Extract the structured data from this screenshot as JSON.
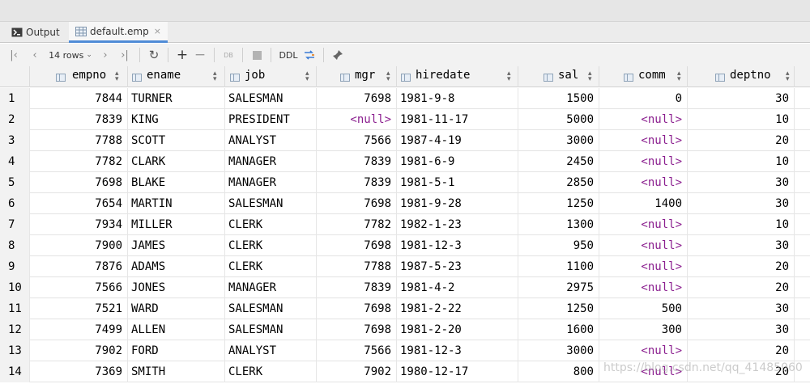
{
  "tabs": [
    {
      "label": "Output",
      "icon": "output-console-icon"
    },
    {
      "label": "default.emp",
      "icon": "table-grid-icon",
      "close": "×"
    }
  ],
  "toolbar": {
    "rows_label": "14 rows",
    "ddl_label": "DDL",
    "icons": [
      "first-page-icon",
      "prev-page-icon",
      "next-page-icon",
      "last-page-icon",
      "refresh-icon",
      "add-row-icon",
      "remove-row-icon",
      "db-submit-icon",
      "stop-icon",
      "compare-icon",
      "pin-icon"
    ]
  },
  "columns": [
    "empno",
    "ename",
    "job",
    "mgr",
    "hiredate",
    "sal",
    "comm",
    "deptno"
  ],
  "null_text": "<null>",
  "rows": [
    [
      "1",
      "7844",
      "TURNER",
      "SALESMAN",
      "7698",
      "1981-9-8",
      "1500",
      "0",
      "30"
    ],
    [
      "2",
      "7839",
      "KING",
      "PRESIDENT",
      "<null>",
      "1981-11-17",
      "5000",
      "<null>",
      "10"
    ],
    [
      "3",
      "7788",
      "SCOTT",
      "ANALYST",
      "7566",
      "1987-4-19",
      "3000",
      "<null>",
      "20"
    ],
    [
      "4",
      "7782",
      "CLARK",
      "MANAGER",
      "7839",
      "1981-6-9",
      "2450",
      "<null>",
      "10"
    ],
    [
      "5",
      "7698",
      "BLAKE",
      "MANAGER",
      "7839",
      "1981-5-1",
      "2850",
      "<null>",
      "30"
    ],
    [
      "6",
      "7654",
      "MARTIN",
      "SALESMAN",
      "7698",
      "1981-9-28",
      "1250",
      "1400",
      "30"
    ],
    [
      "7",
      "7934",
      "MILLER",
      "CLERK",
      "7782",
      "1982-1-23",
      "1300",
      "<null>",
      "10"
    ],
    [
      "8",
      "7900",
      "JAMES",
      "CLERK",
      "7698",
      "1981-12-3",
      "950",
      "<null>",
      "30"
    ],
    [
      "9",
      "7876",
      "ADAMS",
      "CLERK",
      "7788",
      "1987-5-23",
      "1100",
      "<null>",
      "20"
    ],
    [
      "10",
      "7566",
      "JONES",
      "MANAGER",
      "7839",
      "1981-4-2",
      "2975",
      "<null>",
      "20"
    ],
    [
      "11",
      "7521",
      "WARD",
      "SALESMAN",
      "7698",
      "1981-2-22",
      "1250",
      "500",
      "30"
    ],
    [
      "12",
      "7499",
      "ALLEN",
      "SALESMAN",
      "7698",
      "1981-2-20",
      "1600",
      "300",
      "30"
    ],
    [
      "13",
      "7902",
      "FORD",
      "ANALYST",
      "7566",
      "1981-12-3",
      "3000",
      "<null>",
      "20"
    ],
    [
      "14",
      "7369",
      "SMITH",
      "CLERK",
      "7902",
      "1980-12-17",
      "800",
      "<null>",
      "20"
    ]
  ],
  "watermark": "https://blog.csdn.net/qq_41485060",
  "colors": {
    "null": "#8b1f8f",
    "accent": "#4f8bd6"
  }
}
